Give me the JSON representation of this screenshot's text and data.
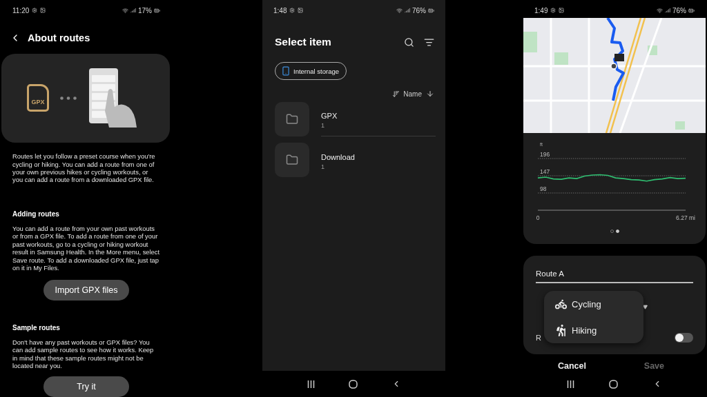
{
  "about_screen": {
    "status_bar": {
      "time": "11:20",
      "battery": "17%"
    },
    "title": "About routes",
    "illustration": {
      "file_label": "GPX"
    },
    "intro": "Routes let you follow a preset course when you're cycling or hiking. You can add a route from one of your own previous hikes or cycling workouts, or you can add a route from a downloaded GPX file.",
    "sections": [
      {
        "heading": "Adding routes",
        "body": "You can add a route from your own past workouts or from a GPX file. To add a route from one of your past workouts, go to a cycling or hiking workout result in Samsung Health. In the More menu, select Save route. To add a downloaded GPX file, just tap on it in My Files.",
        "button": "Import GPX files"
      },
      {
        "heading": "Sample routes",
        "body": "Don't have any past workouts or GPX files? You can add sample routes to see how it works. Keep in mind that these sample routes might not be located near you.",
        "button": "Try it"
      }
    ]
  },
  "select_screen": {
    "status_bar": {
      "time": "1:48",
      "battery": "76%"
    },
    "title": "Select item",
    "storage_chip": "Internal storage",
    "sort_label": "Name",
    "folders": [
      {
        "name": "GPX",
        "count": "1"
      },
      {
        "name": "Download",
        "count": "1"
      }
    ]
  },
  "route_screen": {
    "status_bar": {
      "time": "1:49",
      "battery": "76%"
    },
    "elevation": {
      "chart_data": {
        "type": "line",
        "ylabel": "ft",
        "x": [
          0,
          0.33,
          0.66,
          0.99,
          1.32,
          1.65,
          1.98,
          2.31,
          2.64,
          2.97,
          3.3,
          3.63,
          3.96,
          4.29,
          4.62,
          4.95,
          5.28,
          5.61,
          5.94,
          6.27
        ],
        "xlim": [
          0,
          6.27
        ],
        "ylim": [
          49,
          196
        ],
        "values": [
          141,
          143,
          138,
          137,
          141,
          139,
          146,
          149,
          150,
          148,
          141,
          139,
          136,
          135,
          132,
          136,
          138,
          142,
          139,
          140
        ],
        "xticks": [
          0,
          {
            "value": 6.27,
            "label": "6.27 mi"
          }
        ],
        "yticks": [
          98,
          147,
          196
        ],
        "grid": true
      }
    },
    "pager": [
      {
        "selected": false
      },
      {
        "selected": true
      }
    ],
    "route_name": "Route A",
    "partial_label": "R",
    "toggle": {
      "on": false
    },
    "menu": [
      {
        "label": "Cycling",
        "kind": "cycling"
      },
      {
        "label": "Hiking",
        "kind": "hiking"
      }
    ],
    "actions": [
      {
        "label": "Cancel",
        "disabled": false
      },
      {
        "label": "Save",
        "disabled": true
      }
    ]
  }
}
